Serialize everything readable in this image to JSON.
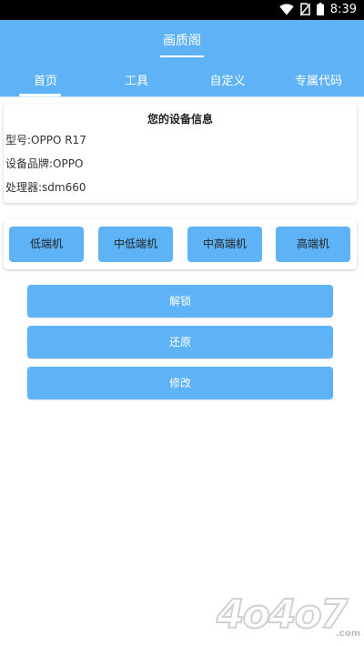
{
  "status_bar": {
    "time": "8:39",
    "icons": [
      "wifi-icon",
      "no-sim-icon",
      "battery-icon"
    ]
  },
  "app_bar": {
    "title": "画质阁"
  },
  "tabs": [
    {
      "label": "首页",
      "active": true
    },
    {
      "label": "工具",
      "active": false
    },
    {
      "label": "自定义",
      "active": false
    },
    {
      "label": "专属代码",
      "active": false
    }
  ],
  "device_info": {
    "title": "您的设备信息",
    "model": "型号:OPPO R17",
    "brand": "设备品牌:OPPO",
    "processor": "处理器:sdm660"
  },
  "tiers": [
    {
      "label": "低端机"
    },
    {
      "label": "中低端机"
    },
    {
      "label": "中高端机"
    },
    {
      "label": "高端机"
    }
  ],
  "actions": {
    "unlock": "解锁",
    "restore": "还原",
    "modify": "修改"
  },
  "watermark": {
    "text": "4o4o7",
    "domain": ".com"
  },
  "colors": {
    "accent": "#5eb3f6",
    "status_bar": "#000000",
    "card": "#ffffff"
  }
}
